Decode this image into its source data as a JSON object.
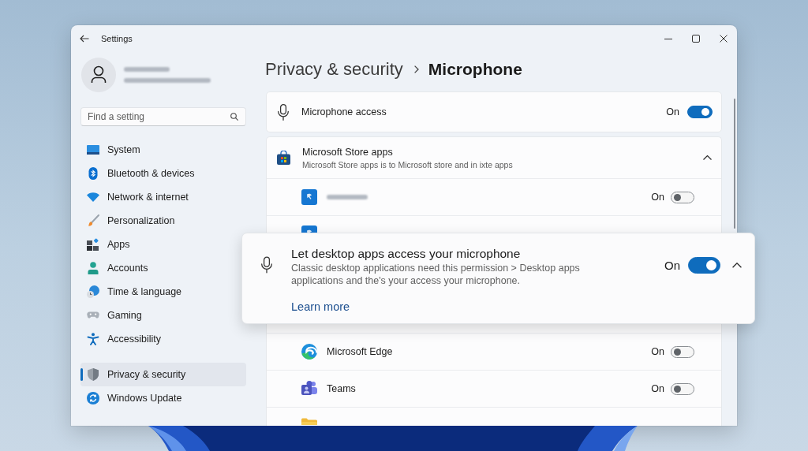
{
  "window": {
    "title": "Settings"
  },
  "search": {
    "placeholder": "Find a setting"
  },
  "sidebar": {
    "sections": [
      {
        "items": [
          {
            "label": "System",
            "kind": "system",
            "selected": false
          },
          {
            "label": "Bluetooth & devices",
            "kind": "bluetooth",
            "selected": false
          },
          {
            "label": "Network & internet",
            "kind": "network",
            "selected": false
          },
          {
            "label": "Personalization",
            "kind": "personalization",
            "selected": false
          },
          {
            "label": "Apps",
            "kind": "apps",
            "selected": false
          },
          {
            "label": "Accounts",
            "kind": "accounts",
            "selected": false
          },
          {
            "label": "Time & language",
            "kind": "time",
            "selected": false
          },
          {
            "label": "Gaming",
            "kind": "gaming",
            "selected": false
          },
          {
            "label": "Accessibility",
            "kind": "accessibility",
            "selected": false
          }
        ]
      },
      {
        "items": [
          {
            "label": "Privacy & security",
            "kind": "privacy",
            "selected": true
          },
          {
            "label": "Windows Update",
            "kind": "update",
            "selected": false
          }
        ]
      }
    ]
  },
  "breadcrumb": {
    "parent": "Privacy & security",
    "current": "Microphone"
  },
  "microphone_access": {
    "label": "Microphone access",
    "state": "On",
    "on": true
  },
  "store_apps": {
    "title": "Microsoft Store apps",
    "subtitle": "Microsoft Store apps is to Microsoft store and in ixte apps",
    "expanded": true
  },
  "apps": [
    {
      "kind": "tile",
      "blurred": true,
      "state": "On",
      "on": false
    },
    {
      "kind": "tile",
      "partial": true
    },
    {
      "kind": "edge",
      "name": "Microsoft Edge",
      "state": "On",
      "on": false
    },
    {
      "kind": "teams",
      "name": "Teams",
      "state": "On",
      "on": false
    },
    {
      "kind": "folder",
      "partial": true
    }
  ],
  "desktop_apps": {
    "title": "Let desktop apps access your microphone",
    "description": "Classic desktop applications need this permission > Desktop apps applications and the's your access your microphone.",
    "link": "Learn more",
    "state": "On",
    "on": true,
    "expanded": true
  }
}
